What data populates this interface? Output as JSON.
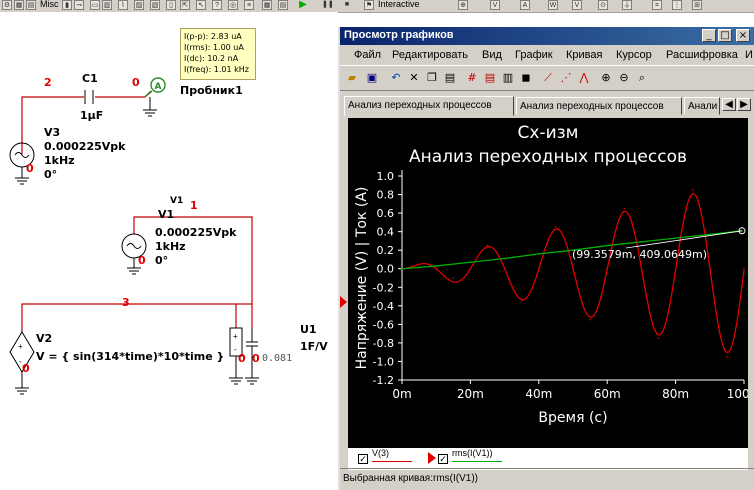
{
  "toolbar": {
    "items": [
      "Misc",
      "Interactive"
    ],
    "interactive_label": "Interactive"
  },
  "schematic": {
    "c1": {
      "name": "C1",
      "value": "1µF"
    },
    "probe": {
      "name": "Пробник1",
      "symbol": "A",
      "readings": [
        "I(p-p): 2.83 uA",
        "I(rms): 1.00 uA",
        "I(dc): 10.2 nA",
        "I(freq): 1.01 kHz"
      ]
    },
    "v3": {
      "name": "V3",
      "amplitude": "0.000225Vpk",
      "freq": "1kHz",
      "phase": "0°"
    },
    "v1": {
      "name": "V1",
      "amplitude": "0.000225Vpk",
      "freq": "1kHz",
      "phase": "0°",
      "partial_label": "V1"
    },
    "v2": {
      "name": "V2",
      "expr": "V = { sin(314*time)*10*time }"
    },
    "u1": {
      "name": "U1",
      "value": "1F/V",
      "readout": "0.081"
    },
    "nodes": {
      "n2": "2",
      "n0a": "0",
      "n0b": "0",
      "n0c": "0",
      "n1": "1",
      "n3": "3",
      "n0d": "0",
      "n0e": "0",
      "n0f": "0",
      "n0g": "0"
    }
  },
  "grapher": {
    "title": "Просмотр графиков",
    "window_buttons": [
      "_",
      "□",
      "×"
    ],
    "menu": [
      "Файл",
      "Редактировать",
      "Вид",
      "График",
      "Кривая",
      "Курсор",
      "Расшифровка",
      "И"
    ],
    "tabs": [
      "Анализ переходных процессов",
      "Анализ переходных процессов",
      "Анали"
    ],
    "status": "Выбранная кривая:rms(I(V1))",
    "cursor_label": "(99.3579m, 409.0649m)",
    "legend": [
      {
        "name": "V(3)",
        "color": "#e00000"
      },
      {
        "name": "rms(I(V1))",
        "color": "#00b000"
      }
    ],
    "colors": {
      "background": "#000000",
      "series_red": "#e00000",
      "series_green": "#00b000",
      "text": "#ffffff"
    }
  },
  "chart_data": {
    "type": "line",
    "title": "Сх-изм",
    "subtitle": "Анализ переходных процессов",
    "xlabel": "Время (с)",
    "ylabel": "Напряжение (V) | Ток (A)",
    "xlim": [
      0,
      0.1
    ],
    "ylim": [
      -1.2,
      1.0
    ],
    "x_ticks": [
      "0m",
      "20m",
      "40m",
      "60m",
      "80m",
      "100m"
    ],
    "y_ticks": [
      "1.0",
      "0.8",
      "0.6",
      "0.4",
      "0.2",
      "0.0",
      "-0.2",
      "-0.4",
      "-0.6",
      "-0.8",
      "-1.0",
      "-1.2"
    ],
    "grid": false,
    "series": [
      {
        "name": "V(3)",
        "color": "#e00000",
        "x": [
          0,
          0.005,
          0.01,
          0.015,
          0.02,
          0.025,
          0.03,
          0.035,
          0.04,
          0.045,
          0.05,
          0.055,
          0.06,
          0.065,
          0.07,
          0.075,
          0.08,
          0.085,
          0.09,
          0.095,
          0.1
        ],
        "y": [
          0,
          0.05,
          0,
          -0.1,
          0,
          0.25,
          0,
          -0.35,
          0,
          0.45,
          0,
          -0.55,
          0,
          0.65,
          0,
          -0.75,
          0,
          0.85,
          0,
          -0.95,
          0
        ]
      },
      {
        "name": "rms(I(V1))",
        "color": "#00b000",
        "x": [
          0,
          0.01,
          0.02,
          0.03,
          0.04,
          0.05,
          0.06,
          0.07,
          0.08,
          0.09,
          0.0994
        ],
        "y": [
          0,
          0.03,
          0.07,
          0.11,
          0.16,
          0.2,
          0.25,
          0.29,
          0.33,
          0.37,
          0.409
        ]
      }
    ]
  }
}
